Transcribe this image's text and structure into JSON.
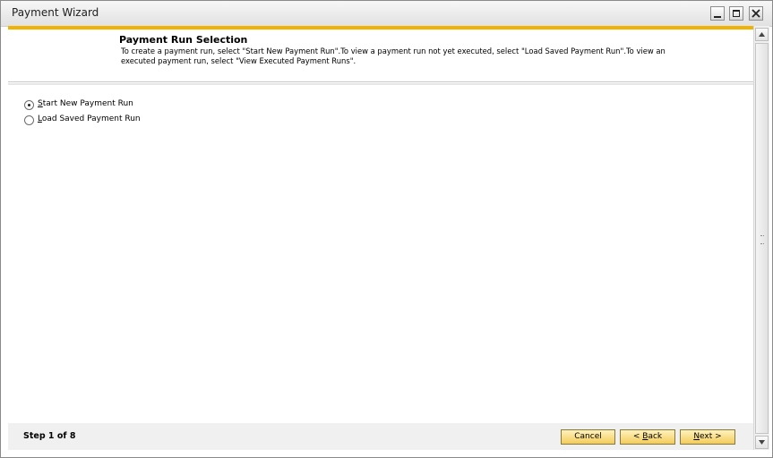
{
  "window": {
    "title": "Payment Wizard",
    "accent_color": "#f0b400"
  },
  "header": {
    "title": "Payment Run Selection",
    "description": "To create a payment run, select \"Start New Payment Run\".To view a payment run not yet executed, select \"Load Saved Payment Run\".To view an executed payment run, select \"View Executed Payment Runs\"."
  },
  "options": [
    {
      "label_mnemonic": "S",
      "label_rest": "tart New Payment Run",
      "selected": true
    },
    {
      "label_mnemonic": "L",
      "label_rest": "oad Saved Payment Run",
      "selected": false
    }
  ],
  "footer": {
    "step_text": "Step 1 of 8",
    "cancel_label": "Cancel",
    "back_prefix": "< ",
    "back_mnemonic": "B",
    "back_rest": "ack",
    "next_mnemonic": "N",
    "next_rest": "ext >",
    "button_color": "#f3cc5a"
  },
  "icons": {
    "minimize": "minimize-icon",
    "maximize": "maximize-icon",
    "close": "close-icon",
    "scroll_up": "chevron-up-icon",
    "scroll_down": "chevron-down-icon"
  }
}
